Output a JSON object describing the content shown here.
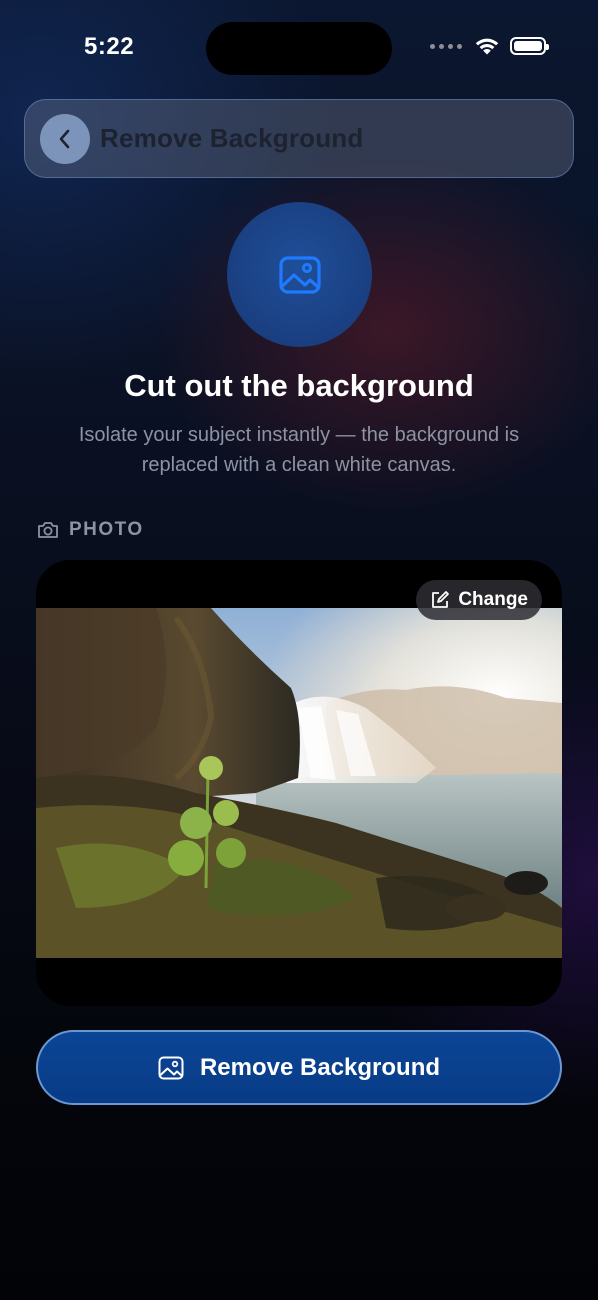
{
  "status_bar": {
    "time": "5:22"
  },
  "header": {
    "title": "Remove Background",
    "back_icon": "chevron-left-icon"
  },
  "hero": {
    "icon": "photo-icon",
    "title": "Cut out the background",
    "subtitle": "Isolate your subject instantly — the background is replaced with a clean white canvas."
  },
  "photo_section": {
    "label": "PHOTO",
    "label_icon": "camera-icon",
    "change_label": "Change",
    "change_icon": "edit-icon"
  },
  "action": {
    "label": "Remove Background",
    "icon": "photo-icon"
  },
  "colors": {
    "accent": "#0b4596",
    "hero_icon": "#1e7bff"
  }
}
